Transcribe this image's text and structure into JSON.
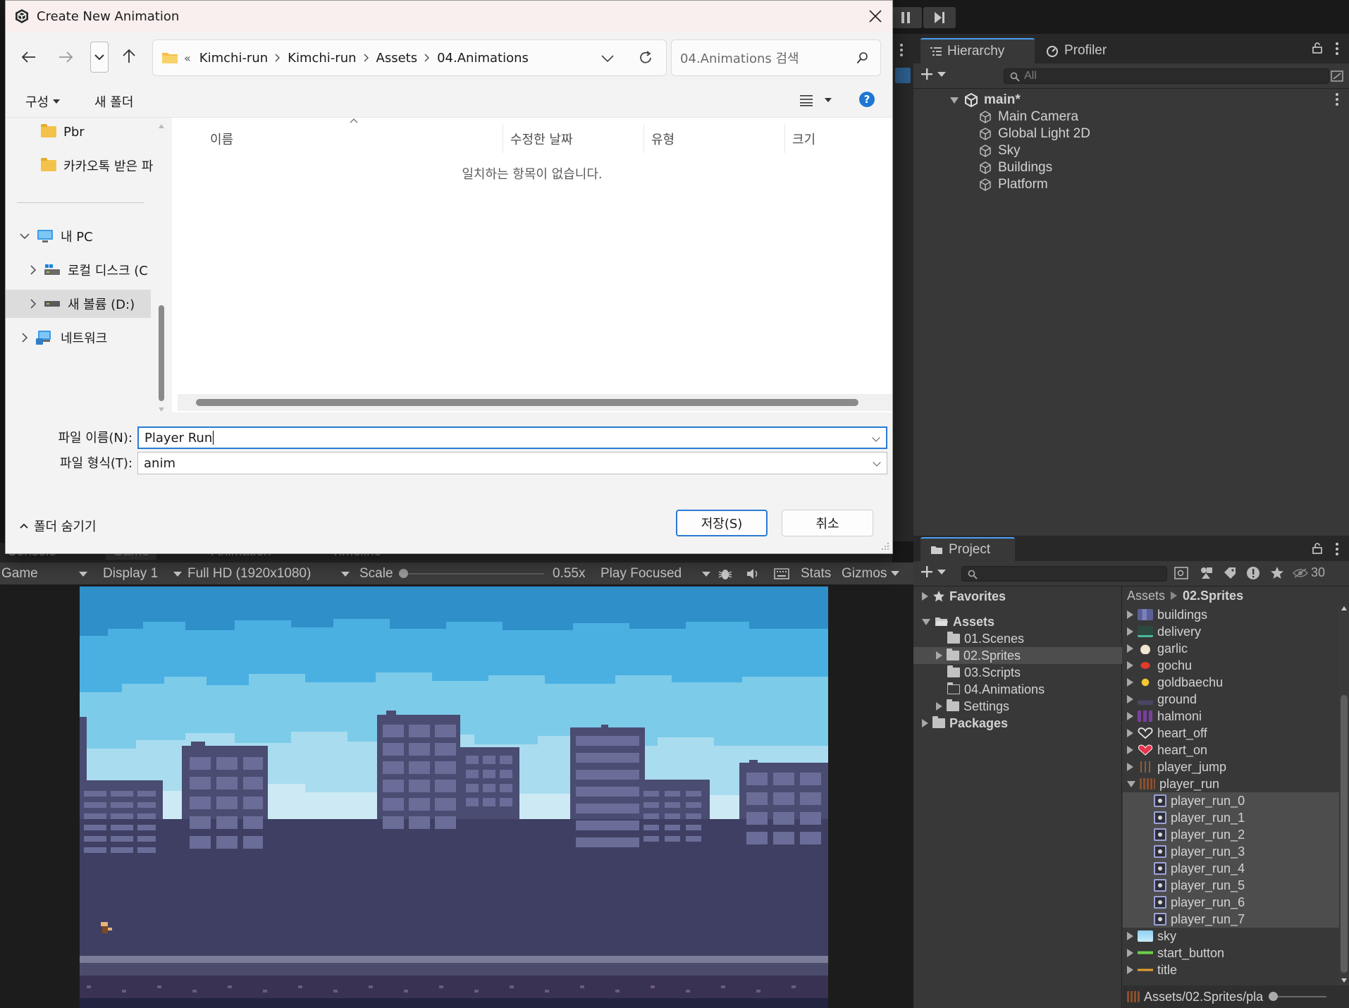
{
  "dialog": {
    "title": "Create New Animation",
    "breadcrumb": [
      "Kimchi-run",
      "Kimchi-run",
      "Assets",
      "04.Animations"
    ],
    "breadcrumb_overflow": "«",
    "search_placeholder": "04.Animations 검색",
    "organize_label": "구성",
    "new_folder_label": "새 폴더",
    "nav_items": {
      "pbr": "Pbr",
      "kakao": "카카오톡 받은 파",
      "this_pc": "내 PC",
      "local_disk": "로컬 디스크 (C",
      "new_volume": "새 볼륨 (D:)",
      "network": "네트워크"
    },
    "columns": [
      "이름",
      "수정한 날짜",
      "유형",
      "크기"
    ],
    "empty_message": "일치하는 항목이 없습니다.",
    "filename_label": "파일 이름(N):",
    "filename_value": "Player Run",
    "filetype_label": "파일 형식(T):",
    "filetype_value": "anim",
    "hide_folders_label": "폴더 숨기기",
    "save_label": "저장(S)",
    "cancel_label": "취소"
  },
  "hierarchy": {
    "tab_label": "Hierarchy",
    "profiler_label": "Profiler",
    "search_placeholder": "All",
    "scene_name": "main*",
    "objects": [
      "Main Camera",
      "Global Light 2D",
      "Sky",
      "Buildings",
      "Platform"
    ]
  },
  "game_toolbar": {
    "background_tabs": [
      "Console",
      "Game",
      "Animation",
      "Timeline"
    ],
    "view_mode": "Game",
    "display": "Display 1",
    "resolution": "Full HD (1920x1080)",
    "scale_label": "Scale",
    "scale_value": "0.55x",
    "play_mode": "Play Focused",
    "stats_label": "Stats",
    "gizmos_label": "Gizmos",
    "scale_fraction": 0.0
  },
  "project": {
    "tab_label": "Project",
    "hidden_count": "30",
    "favorites_label": "Favorites",
    "assets_label": "Assets",
    "packages_label": "Packages",
    "asset_folders": [
      "01.Scenes",
      "02.Sprites",
      "03.Scripts",
      "04.Animations",
      "Settings"
    ],
    "breadcrumb_root": "Assets",
    "breadcrumb_current": "02.Sprites",
    "sprites": [
      "buildings",
      "delivery",
      "garlic",
      "gochu",
      "goldbaechu",
      "ground",
      "halmoni",
      "heart_off",
      "heart_on",
      "player_jump",
      "player_run"
    ],
    "player_run_frames": [
      "player_run_0",
      "player_run_1",
      "player_run_2",
      "player_run_3",
      "player_run_4",
      "player_run_5",
      "player_run_6",
      "player_run_7"
    ],
    "sprites_after": [
      "sky",
      "start_button",
      "title"
    ],
    "status_path": "Assets/02.Sprites/pla"
  },
  "colors": {
    "accent": "#2a7ad5",
    "unity_panel": "#383838",
    "unity_selection": "#4d4d4d",
    "sky_top": "#2f8fc9",
    "building": "#4a4c72"
  }
}
